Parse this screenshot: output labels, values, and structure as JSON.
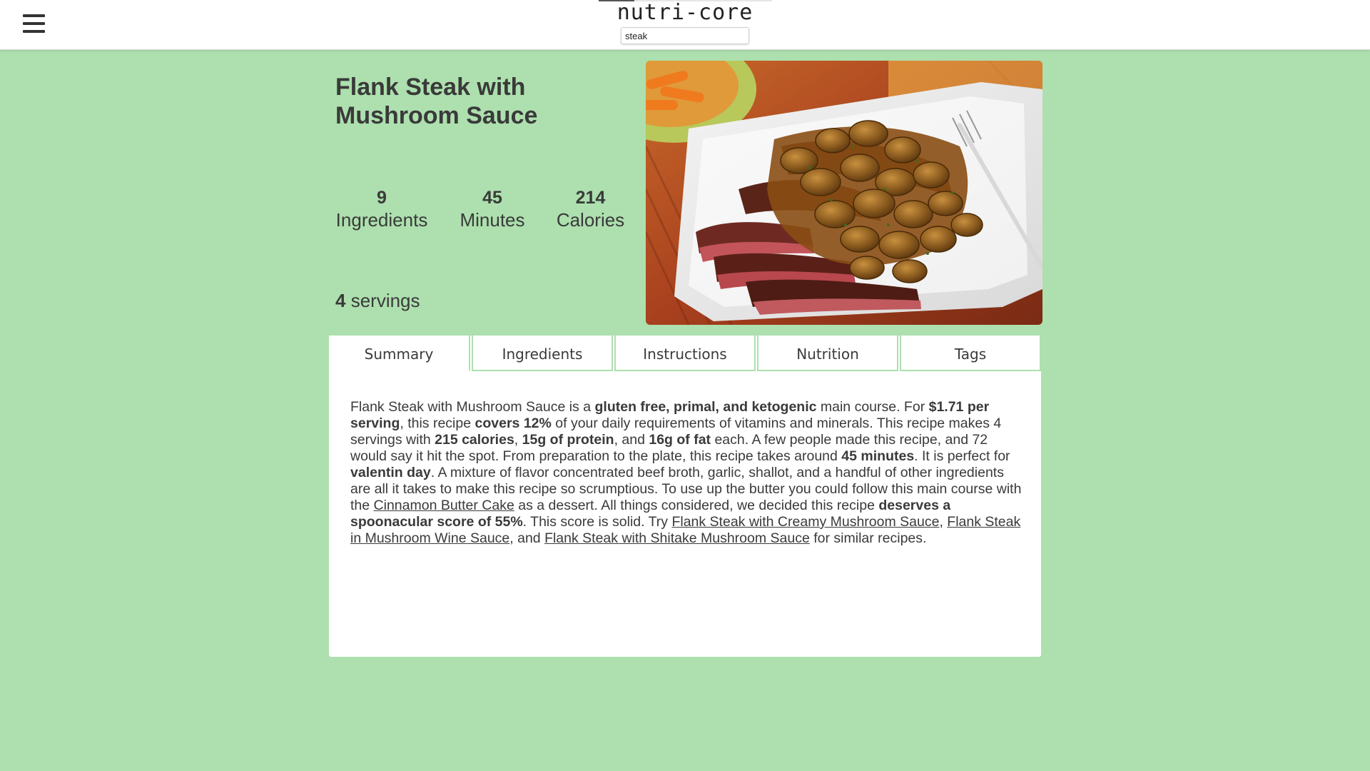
{
  "header": {
    "brand": "nutri-core",
    "search_value": "steak",
    "menu_icon": "hamburger-menu-icon"
  },
  "recipe": {
    "title": "Flank Steak with Mushroom Sauce",
    "stats": [
      {
        "value": "9",
        "label": "Ingredients"
      },
      {
        "value": "45",
        "label": "Minutes"
      },
      {
        "value": "214",
        "label": "Calories"
      }
    ],
    "servings_count": "4",
    "servings_label": "servings",
    "image_alt": "flank steak with mushroom sauce photo"
  },
  "tabs": [
    "Summary",
    "Ingredients",
    "Instructions",
    "Nutrition",
    "Tags"
  ],
  "active_tab": "Summary",
  "summary": {
    "t1": "Flank Steak with Mushroom Sauce is a ",
    "b1": "gluten free, primal, and ketogenic",
    "t2": " main course. For ",
    "b2": "$1.71 per serving",
    "t3": ", this recipe ",
    "b3": "covers 12%",
    "t4": " of your daily requirements of vitamins and minerals. This recipe makes 4 servings with ",
    "b4": "215 calories",
    "t5": ", ",
    "b5": "15g of protein",
    "t6": ", and ",
    "b6": "16g of fat",
    "t7": " each. A few people made this recipe, and 72 would say it hit the spot. From preparation to the plate, this recipe takes around ",
    "b7": "45 minutes",
    "t8": ". It is perfect for ",
    "b8": "valentin day",
    "t9": ". A mixture of flavor concentrated beef broth, garlic, shallot, and a handful of other ingredients are all it takes to make this recipe so scrumptious. To use up the butter you could follow this main course with the ",
    "l1": "Cinnamon Butter Cake",
    "t10": " as a dessert. All things considered, we decided this recipe ",
    "b9": "deserves a spoonacular score of 55%",
    "t11": ". This score is solid. Try ",
    "l2": "Flank Steak with Creamy Mushroom Sauce",
    "t12": ", ",
    "l3": "Flank Steak in Mushroom Wine Sauce",
    "t13": ", and ",
    "l4": "Flank Steak with Shitake Mushroom Sauce",
    "t14": " for similar recipes."
  },
  "colors": {
    "background": "#ade0ae",
    "header_bg": "#ffffff",
    "card_bg": "#ffffff",
    "text": "#333333"
  }
}
